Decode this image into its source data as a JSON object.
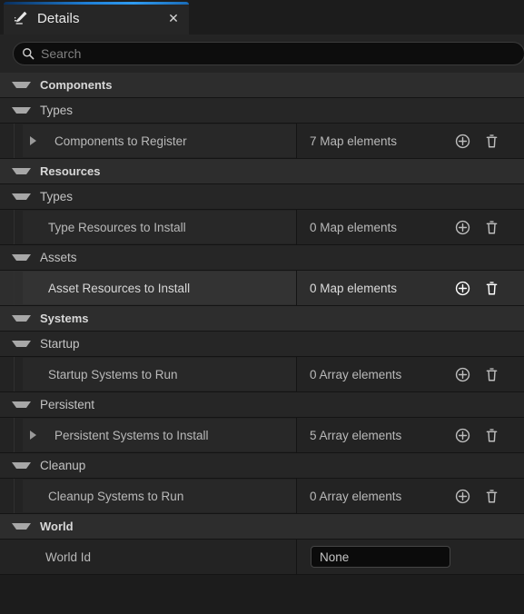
{
  "tab": {
    "title": "Details",
    "icon": "details-pencil-icon",
    "close_label": "✕"
  },
  "search": {
    "placeholder": "Search",
    "value": "",
    "icon": "search-icon"
  },
  "colors": {
    "accent": "#2f9bf0",
    "panel_bg": "#1f1f1f",
    "row_bg": "#232323",
    "row_hover_bg": "#2e2e2e",
    "category_bg": "#2d2d2d",
    "group_bg": "#262626",
    "field_bg": "#0b0b0b",
    "text": "#b9b9b9"
  },
  "icons": {
    "add": "plus-circle-icon",
    "remove": "trash-icon",
    "expanded": "triangle-down-icon",
    "collapsed": "triangle-right-icon"
  },
  "rows": [
    {
      "kind": "category",
      "name": "category-components",
      "label": "Components",
      "twisty": "down",
      "indent": 0
    },
    {
      "kind": "group",
      "name": "group-components-types",
      "label": "Types",
      "twisty": "down",
      "indent": 0
    },
    {
      "kind": "prop",
      "name": "property-components-to-register",
      "label": "Components to Register",
      "twisty": "right",
      "indent": 1,
      "value": "7 Map elements",
      "actions": [
        "add",
        "remove"
      ],
      "hover": false
    },
    {
      "kind": "category",
      "name": "category-resources",
      "label": "Resources",
      "twisty": "down",
      "indent": 0
    },
    {
      "kind": "group",
      "name": "group-resources-types",
      "label": "Types",
      "twisty": "down",
      "indent": 0
    },
    {
      "kind": "prop",
      "name": "property-type-resources-to-install",
      "label": "Type Resources to Install",
      "twisty": "none",
      "indent": 1,
      "value": "0 Map elements",
      "actions": [
        "add",
        "remove"
      ],
      "hover": false
    },
    {
      "kind": "group",
      "name": "group-resources-assets",
      "label": "Assets",
      "twisty": "down",
      "indent": 0
    },
    {
      "kind": "prop",
      "name": "property-asset-resources-to-install",
      "label": "Asset Resources to Install",
      "twisty": "none",
      "indent": 1,
      "value": "0 Map elements",
      "actions": [
        "add",
        "remove"
      ],
      "hover": true
    },
    {
      "kind": "category",
      "name": "category-systems",
      "label": "Systems",
      "twisty": "down",
      "indent": 0
    },
    {
      "kind": "group",
      "name": "group-systems-startup",
      "label": "Startup",
      "twisty": "down",
      "indent": 0
    },
    {
      "kind": "prop",
      "name": "property-startup-systems-to-run",
      "label": "Startup Systems to Run",
      "twisty": "none",
      "indent": 1,
      "value": "0 Array elements",
      "actions": [
        "add",
        "remove"
      ],
      "hover": false
    },
    {
      "kind": "group",
      "name": "group-systems-persistent",
      "label": "Persistent",
      "twisty": "down",
      "indent": 0
    },
    {
      "kind": "prop",
      "name": "property-persistent-systems-to-install",
      "label": "Persistent Systems to Install",
      "twisty": "right",
      "indent": 1,
      "value": "5 Array elements",
      "actions": [
        "add",
        "remove"
      ],
      "hover": false
    },
    {
      "kind": "group",
      "name": "group-systems-cleanup",
      "label": "Cleanup",
      "twisty": "down",
      "indent": 0
    },
    {
      "kind": "prop",
      "name": "property-cleanup-systems-to-run",
      "label": "Cleanup Systems to Run",
      "twisty": "none",
      "indent": 1,
      "value": "0 Array elements",
      "actions": [
        "add",
        "remove"
      ],
      "hover": false
    },
    {
      "kind": "category",
      "name": "category-world",
      "label": "World",
      "twisty": "down",
      "indent": 0
    },
    {
      "kind": "prop",
      "name": "property-world-id",
      "label": "World Id",
      "twisty": "none",
      "indent": 0,
      "field": "None",
      "actions": [],
      "hover": false
    }
  ]
}
